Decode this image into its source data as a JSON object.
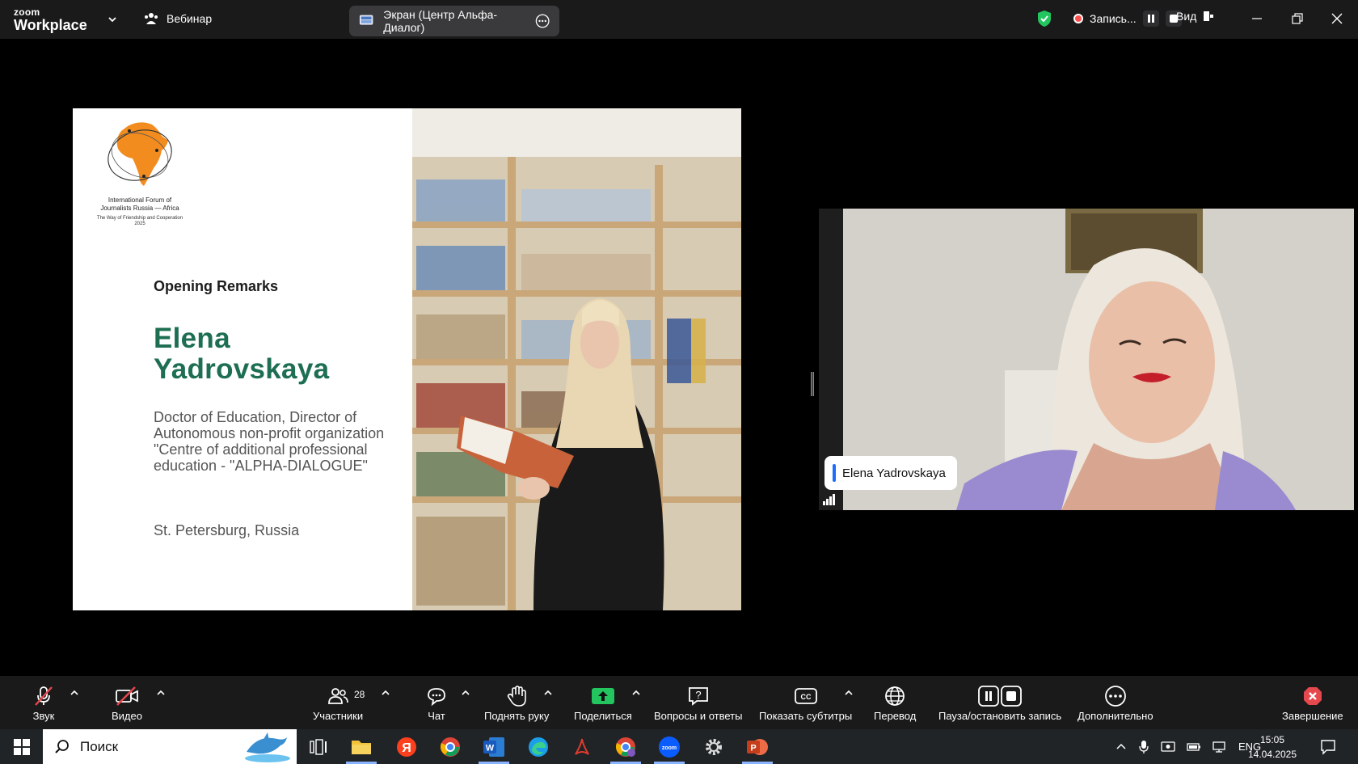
{
  "app": {
    "logo_top": "zoom",
    "logo_bottom": "Workplace",
    "meeting_type": "Вебинар",
    "share_label": "Экран (Центр Альфа-Диалог)",
    "recording_label": "Запись...",
    "view_label": "Вид"
  },
  "slide": {
    "forum_name": "International Forum of Journalists Russia — Africa",
    "forum_tagline": "The Way of Friendship and Cooperation 2025",
    "section": "Opening Remarks",
    "speaker_first": "Elena",
    "speaker_last": "Yadrovskaya",
    "credentials": "Doctor of Education, Director of Autonomous non-profit organization  \"Centre of additional professional education - \"ALPHA-DIALOGUE\"",
    "city": "St. Petersburg, Russia"
  },
  "video": {
    "participant_name": "Elena Yadrovskaya"
  },
  "toolbar": {
    "audio": "Звук",
    "video": "Видео",
    "participants": "Участники",
    "participants_count": "28",
    "chat": "Чат",
    "raise_hand": "Поднять руку",
    "share": "Поделиться",
    "qa": "Вопросы и ответы",
    "captions": "Показать субтитры",
    "translate": "Перевод",
    "record": "Пауза/остановить запись",
    "more": "Дополнительно",
    "end": "Завершение"
  },
  "taskbar": {
    "search_placeholder": "Поиск",
    "lang": "ENG",
    "time": "15:05",
    "date": "14.04.2025"
  },
  "colors": {
    "accent_green": "#1e6e52",
    "share_green": "#22c55e",
    "end_red": "#e5484d",
    "shield_green": "#22c55e"
  }
}
